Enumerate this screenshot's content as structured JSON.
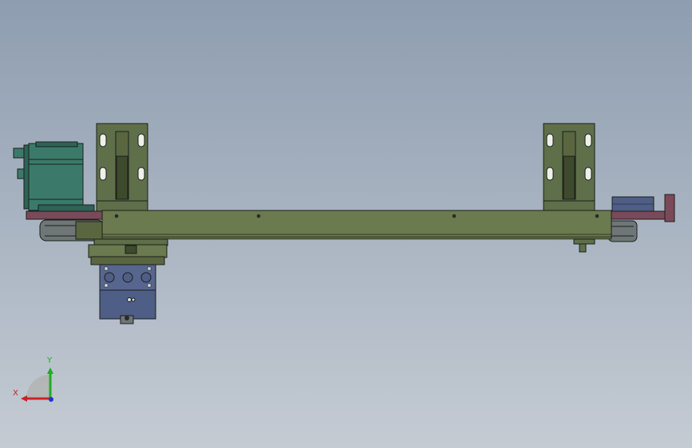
{
  "viewport": {
    "background_top": "#8e9db0",
    "background_bottom": "#c4cbd3"
  },
  "colors": {
    "rail_green": "#6b7a4f",
    "rail_green_dark": "#59663f",
    "motor_teal": "#3b7a6a",
    "motor_teal_dark": "#2e6356",
    "base_plate_maroon": "#7a4a5a",
    "block_slate_blue": "#4e5e86",
    "bracket_green": "#5e6f4a",
    "outline": "#1c1f1a",
    "pulley_gray": "#6f7677"
  },
  "triad": {
    "x_label": "X",
    "y_label": "Y",
    "x_color": "#cc2222",
    "y_color": "#22aa22",
    "z_color": "#2233cc"
  }
}
